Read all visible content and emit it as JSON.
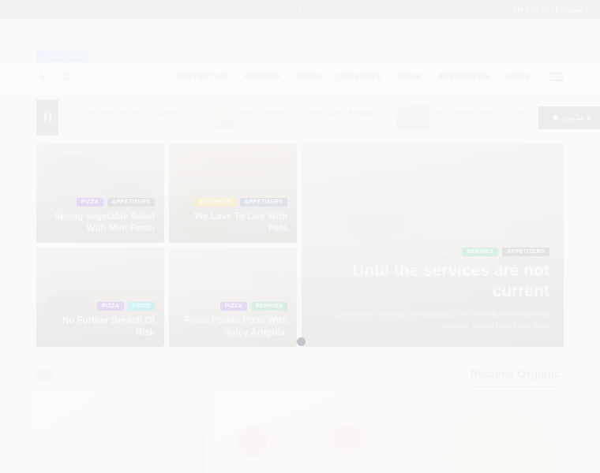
{
  "topbar": {
    "datetime": "۸ بهمن ۱۴۰۲ 9:09:34 AM",
    "pager_prev": "‹",
    "pager_sep": "|",
    "pager_next": "›"
  },
  "strip": {
    "random_post_label": "مطلب تصادفی",
    "random_post_icon": "↯",
    "marquee_text": "این مطلب یک شروع است"
  },
  "live": {
    "badge_label": "Live Now"
  },
  "header": {
    "dark_mode_icon": "moon-icon",
    "search_icon": "search-icon",
    "nav": [
      {
        "label": "CONTACT US"
      },
      {
        "label": "BERRIES"
      },
      {
        "label": "FOOD"
      },
      {
        "label": "DESSERTS"
      },
      {
        "label": "PIZZA"
      },
      {
        "label": "APPETIZERS"
      },
      {
        "label": "HOME"
      }
    ],
    "menu_icon": "hamburger-icon"
  },
  "ticker": {
    "pause_icon": "pause-icon",
    "count_badge": "۵ عناوین",
    "count_icon": "◆",
    "items": [
      {
        "title": "Until the services are not current",
        "time": "2 سال Ago"
      },
      {
        "title": "Pesto Potato Pizza With Spicy Arugula.",
        "time": "2 سال Ago"
      },
      {
        "title": "No Further Breach Of Risk",
        "time": "2 سال Ago"
      }
    ]
  },
  "hero": {
    "cards": [
      {
        "title": "Spring Vegetable Salad With Mint Pesto",
        "tags": [
          {
            "label": "PIZZA",
            "color": "#9b6fd4"
          },
          {
            "label": "APPETIZERS",
            "color": "#8f949c"
          }
        ]
      },
      {
        "title": "We Love To Live With Pets",
        "tags": [
          {
            "label": "DESSERTS",
            "color": "#e3c65b"
          },
          {
            "label": "APPETIZERS",
            "color": "#7f93ad"
          }
        ]
      },
      {
        "title": "No Further Breach Of Risk",
        "tags": [
          {
            "label": "PIZZA",
            "color": "#9b6fd4"
          },
          {
            "label": "FOOD",
            "color": "#56c4d8"
          }
        ]
      },
      {
        "title": "Pesto Potato Pizza With Spicy Arugula.",
        "tags": [
          {
            "label": "PIZZA",
            "color": "#9b6fd4"
          },
          {
            "label": "BERRIES",
            "color": "#6fc18a"
          }
        ]
      }
    ],
    "featured": {
      "title": "Until the services are not current",
      "excerpt": "Lorem Ipsum is simply dummy text of the printing and typesetting industry. Lorem Ipsum has been",
      "time": "2 سال Ago",
      "tags": [
        {
          "label": "BERRIES",
          "color": "#6fc18a"
        },
        {
          "label": "APPETIZERS",
          "color": "#8f949c"
        }
      ]
    },
    "carousel_dot": "active"
  },
  "section": {
    "title": "Recipes Organic",
    "prev_arrow": "‹"
  },
  "recipes": {
    "cards": [
      {
        "image_alt": "tiramisu-cake-slice"
      },
      {
        "image_alt": "strawberry-berry-bowl"
      },
      {
        "image_alt": "margherita-pizza"
      }
    ]
  },
  "colors": {
    "topbar_bg": "#b4b8c0",
    "page_bg": "#ececec",
    "accent_purple": "#9b6fd4",
    "accent_green": "#6fc18a",
    "accent_yellow": "#e3c65b",
    "accent_cyan": "#56c4d8",
    "dot": "#121a2e"
  }
}
